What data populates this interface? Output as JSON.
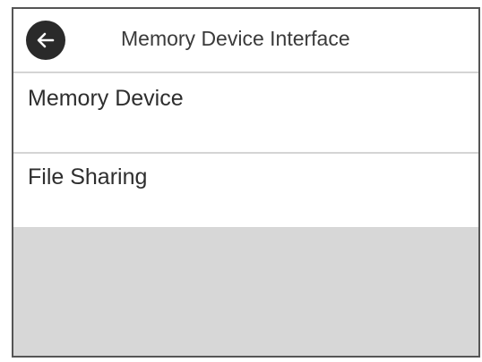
{
  "header": {
    "title": "Memory Device Interface",
    "back_icon": "back-arrow-icon"
  },
  "menu": {
    "items": [
      {
        "label": "Memory Device"
      },
      {
        "label": "File Sharing"
      }
    ]
  },
  "colors": {
    "back_button_bg": "#2a2a2a",
    "divider": "#d4d4d4",
    "empty_area": "#d7d7d7",
    "text": "#2e2e2e"
  }
}
